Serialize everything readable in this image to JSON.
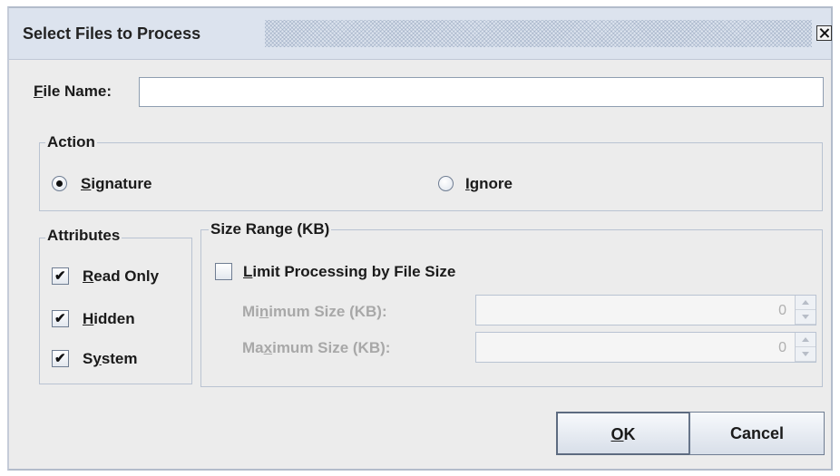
{
  "dialog": {
    "title": "Select Files to Process"
  },
  "file_name": {
    "label_mnemonic": "F",
    "label_rest": "ile Name:",
    "value": ""
  },
  "action": {
    "legend": "Action",
    "signature": {
      "mnemonic": "S",
      "rest": "ignature",
      "checked": true
    },
    "ignore": {
      "mnemonic": "I",
      "rest": "gnore",
      "checked": false
    }
  },
  "attributes": {
    "legend": "Attributes",
    "read_only": {
      "mnemonic": "R",
      "rest": "ead Only",
      "checked": true
    },
    "hidden": {
      "mnemonic": "H",
      "rest": "idden",
      "checked": true
    },
    "system": {
      "pre": "S",
      "mnemonic": "y",
      "rest": "stem",
      "checked": true
    }
  },
  "size_range": {
    "legend": "Size Range (KB)",
    "limit": {
      "mnemonic": "L",
      "rest": "imit Processing by File Size",
      "checked": false
    },
    "minimum": {
      "pre": "Mi",
      "mnemonic": "n",
      "rest": "imum Size (KB):",
      "value": "0"
    },
    "maximum": {
      "pre": "Ma",
      "mnemonic": "x",
      "rest": "imum Size (KB):",
      "value": "0"
    }
  },
  "buttons": {
    "ok": {
      "mnemonic": "O",
      "rest": "K"
    },
    "cancel": "Cancel"
  },
  "colors": {
    "dialog_bg": "#ececec",
    "titlebar_bg": "#dce3ee",
    "disabled_text": "#a8a8a8"
  }
}
